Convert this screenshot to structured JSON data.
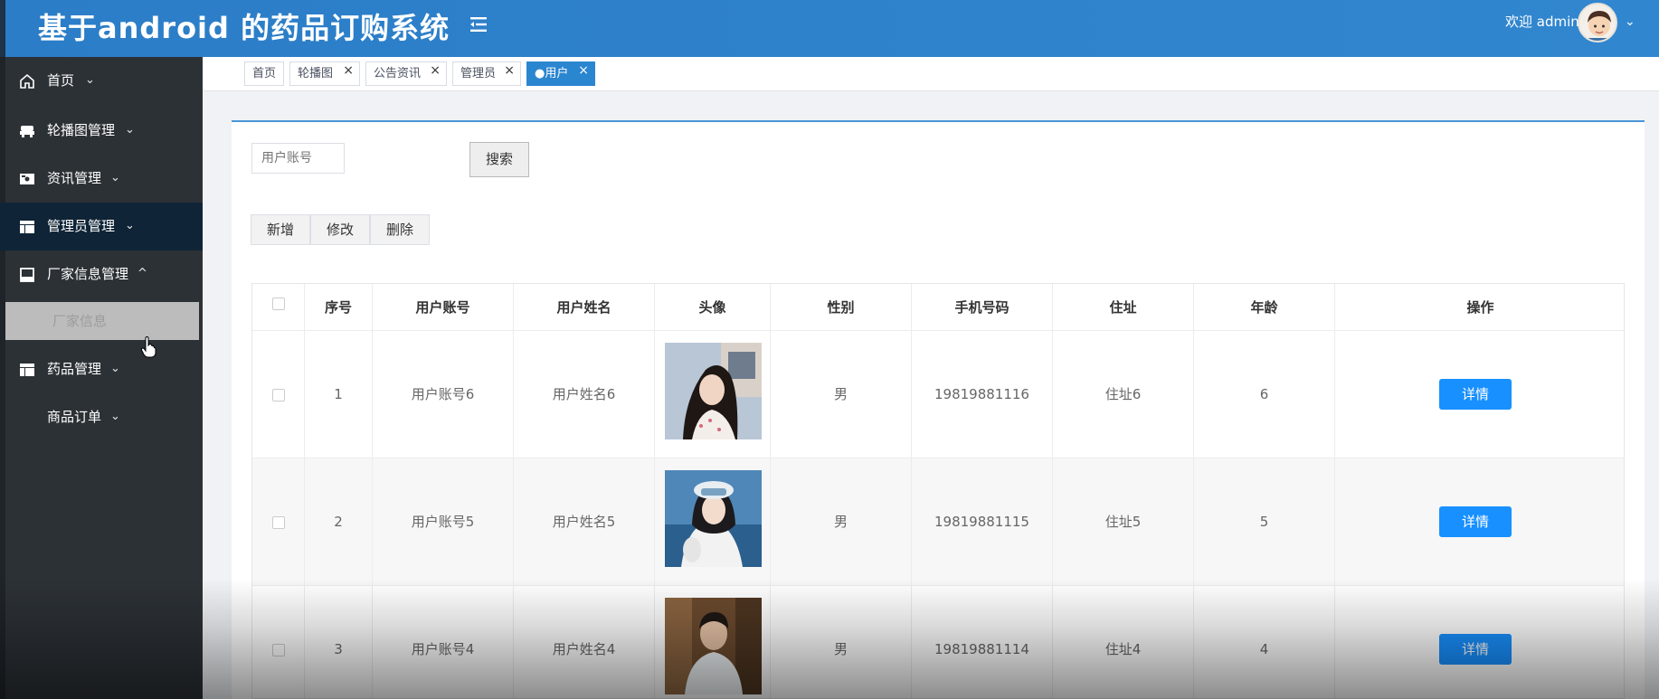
{
  "header": {
    "title": "基于android 的药品订购系统",
    "welcome": "欢迎 admin",
    "accent_color": "#2b7dc7"
  },
  "sidebar": {
    "items": [
      {
        "label": "首页",
        "icon": "home-icon"
      },
      {
        "label": "轮播图管理",
        "icon": "carousel-icon"
      },
      {
        "label": "资讯管理",
        "icon": "news-icon"
      },
      {
        "label": "管理员管理",
        "icon": "table-icon"
      },
      {
        "label": "厂家信息管理",
        "icon": "factory-icon"
      },
      {
        "label": "药品管理",
        "icon": "table-icon"
      },
      {
        "label": "商品订单",
        "icon": ""
      }
    ],
    "active_sub": "厂家信息"
  },
  "tabs": [
    {
      "label": "首页",
      "closable": false
    },
    {
      "label": "轮播图",
      "closable": true
    },
    {
      "label": "公告资讯",
      "closable": true
    },
    {
      "label": "管理员",
      "closable": true
    },
    {
      "label": "●用户",
      "closable": true,
      "active": true
    }
  ],
  "search": {
    "placeholder": "用户账号",
    "button": "搜索"
  },
  "actions": {
    "add": "新增",
    "edit": "修改",
    "delete": "删除"
  },
  "table": {
    "columns": [
      "序号",
      "用户账号",
      "用户姓名",
      "头像",
      "性别",
      "手机号码",
      "住址",
      "年龄",
      "操作"
    ],
    "rows": [
      {
        "index": "1",
        "account": "用户账号6",
        "name": "用户姓名6",
        "gender": "男",
        "phone": "19819881116",
        "address": "住址6",
        "age": "6",
        "action": "详情"
      },
      {
        "index": "2",
        "account": "用户账号5",
        "name": "用户姓名5",
        "gender": "男",
        "phone": "19819881115",
        "address": "住址5",
        "age": "5",
        "action": "详情"
      },
      {
        "index": "3",
        "account": "用户账号4",
        "name": "用户姓名4",
        "gender": "男",
        "phone": "19819881114",
        "address": "住址4",
        "age": "4",
        "action": "详情"
      }
    ]
  }
}
